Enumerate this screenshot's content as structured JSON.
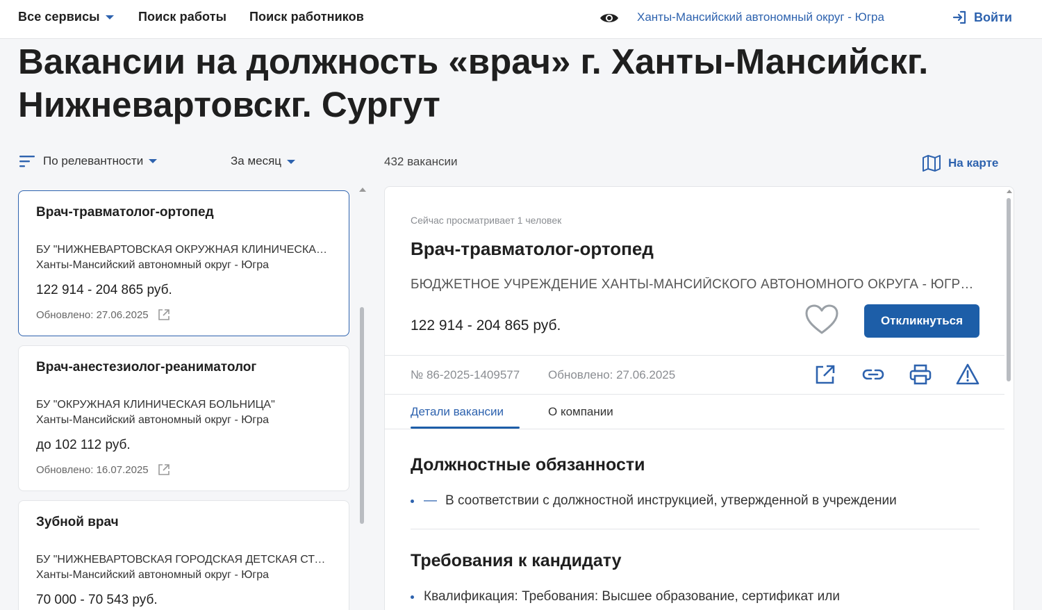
{
  "nav": {
    "all_services": "Все сервисы",
    "job_search": "Поиск работы",
    "worker_search": "Поиск работников",
    "region": "Ханты-Мансийский автономный округ - Югра",
    "login": "Войти"
  },
  "page": {
    "title": "Вакансии на должность «врач» г. Ханты-Мансийскг. Нижневартовскг. Сургут"
  },
  "filters": {
    "sort": "По релевантности",
    "period": "За месяц",
    "count": "432 вакансии",
    "map": "На карте"
  },
  "vacancies": [
    {
      "title": "Врач-травматолог-ортопед",
      "org": "БУ \"НИЖНЕВАРТОВСКАЯ ОКРУЖНАЯ КЛИНИЧЕСКАЯ БОЛЬНИЦА\"",
      "region": "Ханты-Мансийский автономный округ - Югра",
      "salary": "122 914 - 204 865 руб.",
      "updated": "Обновлено: 27.06.2025"
    },
    {
      "title": "Врач-анестезиолог-реаниматолог",
      "org": "БУ \"ОКРУЖНАЯ КЛИНИЧЕСКАЯ БОЛЬНИЦА\"",
      "region": "Ханты-Мансийский автономный округ - Югра",
      "salary": "до 102 112 руб.",
      "updated": "Обновлено: 16.07.2025"
    },
    {
      "title": "Зубной врач",
      "org": "БУ \"НИЖНЕВАРТОВСКАЯ ГОРОДСКАЯ ДЕТСКАЯ СТОМАТОЛОГИЧЕСКАЯ ПОЛИКЛИНИКА\"",
      "region": "Ханты-Мансийский автономный округ - Югра",
      "salary": "70 000 - 70 543 руб."
    }
  ],
  "detail": {
    "viewing": "Сейчас просматривает 1 человек",
    "title": "Врач-травматолог-ортопед",
    "org": "БЮДЖЕТНОЕ УЧРЕЖДЕНИЕ ХАНТЫ-МАНСИЙСКОГО АВТОНОМНОГО ОКРУГА - ЮГРЫ \"НИЖНЕВАРТОВСКАЯ ОКРУЖНАЯ КЛИНИЧЕСКАЯ БОЛЬНИЦА\"",
    "salary": "122 914 - 204 865 руб.",
    "apply": "Откликнуться",
    "number": "№ 86-2025-1409577",
    "updated": "Обновлено: 27.06.2025",
    "tabs": [
      "Детали вакансии",
      "О компании"
    ],
    "duties_heading": "Должностные обязанности",
    "duty_dash": "—",
    "duty": "В соответствии с должностной инструкцией, утвержденной в учреждении",
    "requirements_heading": "Требования к кандидату",
    "requirement": "Квалификация: Требования: Высшее образование, сертификат или"
  },
  "colors": {
    "accent": "#2d62ae",
    "button": "#1d5ea8"
  }
}
